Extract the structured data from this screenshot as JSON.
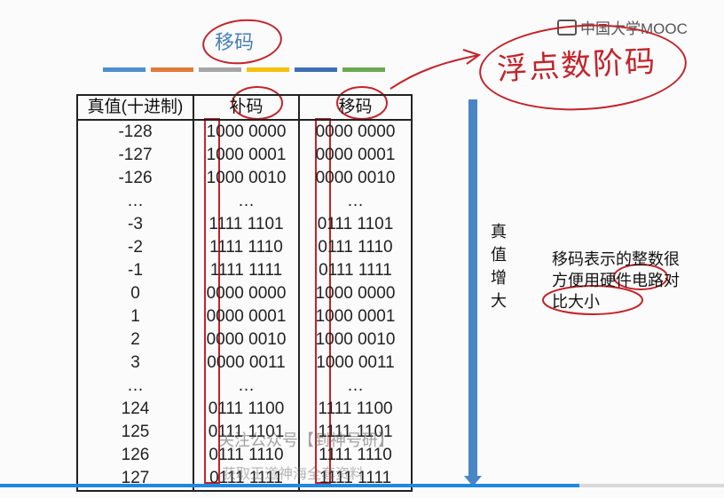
{
  "slide": {
    "title": "移码",
    "color_bars": [
      "#4f8fcf",
      "#e07a3c",
      "#a6a6a6",
      "#f4c20d",
      "#3f6fb5",
      "#6aa84f"
    ],
    "logo_text": "中国大学MOOC",
    "handwritten_note": "浮点数阶码",
    "table": {
      "headers": [
        "真值(十进制)",
        "补码",
        "移码"
      ],
      "rows": [
        [
          "-128",
          "1000 0000",
          "0000 0000"
        ],
        [
          "-127",
          "1000 0001",
          "0000 0001"
        ],
        [
          "-126",
          "1000 0010",
          "0000 0010"
        ],
        [
          "…",
          "…",
          "…"
        ],
        [
          "-3",
          "1111 1101",
          "0111 1101"
        ],
        [
          "-2",
          "1111 1110",
          "0111 1110"
        ],
        [
          "-1",
          "1111 1111",
          "0111 1111"
        ],
        [
          "0",
          "0000 0000",
          "1000 0000"
        ],
        [
          "1",
          "0000 0001",
          "1000 0001"
        ],
        [
          "2",
          "0000 0010",
          "1000 0010"
        ],
        [
          "3",
          "0000 0011",
          "1000 0011"
        ],
        [
          "…",
          "…",
          "…"
        ],
        [
          "124",
          "0111 1100",
          "1111 1100"
        ],
        [
          "125",
          "0111 1101",
          "1111 1101"
        ],
        [
          "126",
          "0111 1110",
          "1111 1110"
        ],
        [
          "127",
          "0111 1111",
          "1111 1111"
        ]
      ]
    },
    "arrow_label": "真值增大",
    "note": "移码表示的整数很方便用硬件电路对比大小",
    "watermark1": "关注公众号【到神号研】",
    "watermark2": "获取王道神海全套资料",
    "accent_color": "#4a86c5",
    "annotation_color": "#c3232a"
  },
  "player": {
    "progress_fraction": 0.8
  }
}
